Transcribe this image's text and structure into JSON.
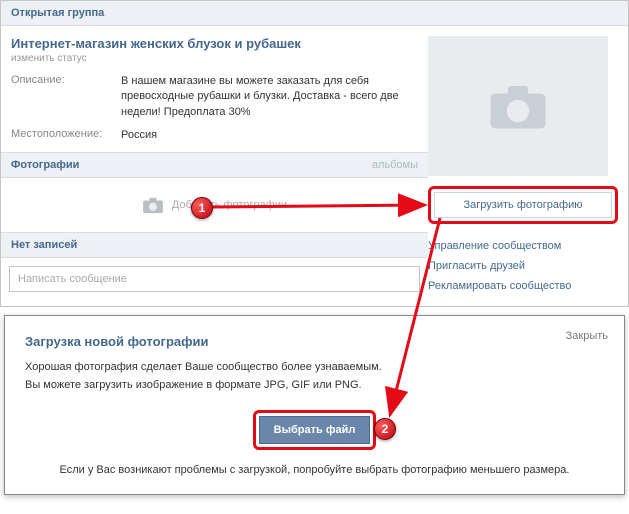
{
  "header": {
    "title": "Открытая группа"
  },
  "group": {
    "title": "Интернет-магазин женских блузок и рубашек",
    "status_change": "изменить статус",
    "desc_label": "Описание:",
    "description": "В нашем магазине вы можете заказать для себя превосходные рубашки и блузки. Доставка - всего две недели! Предоплата 30%",
    "loc_label": "Местоположение:",
    "location": "Россия"
  },
  "photos": {
    "header": "Фотографии",
    "albums": "альбомы",
    "add": "Добавить фотографии"
  },
  "posts": {
    "none": "Нет записей",
    "compose": "Написать сообщение"
  },
  "sidebar": {
    "upload": "Загрузить фотографию",
    "links": [
      "Управление сообществом",
      "Пригласить друзей",
      "Рекламировать сообщество"
    ]
  },
  "modal": {
    "title": "Загрузка новой фотографии",
    "close": "Закрыть",
    "line1": "Хорошая фотография сделает Ваше сообщество более узнаваемым.",
    "line2": "Вы можете загрузить изображение в формате JPG, GIF или PNG.",
    "choose": "Выбрать файл",
    "footer": "Если у Вас возникают проблемы с загрузкой, попробуйте выбрать фотографию меньшего размера."
  },
  "badges": {
    "one": "1",
    "two": "2"
  }
}
